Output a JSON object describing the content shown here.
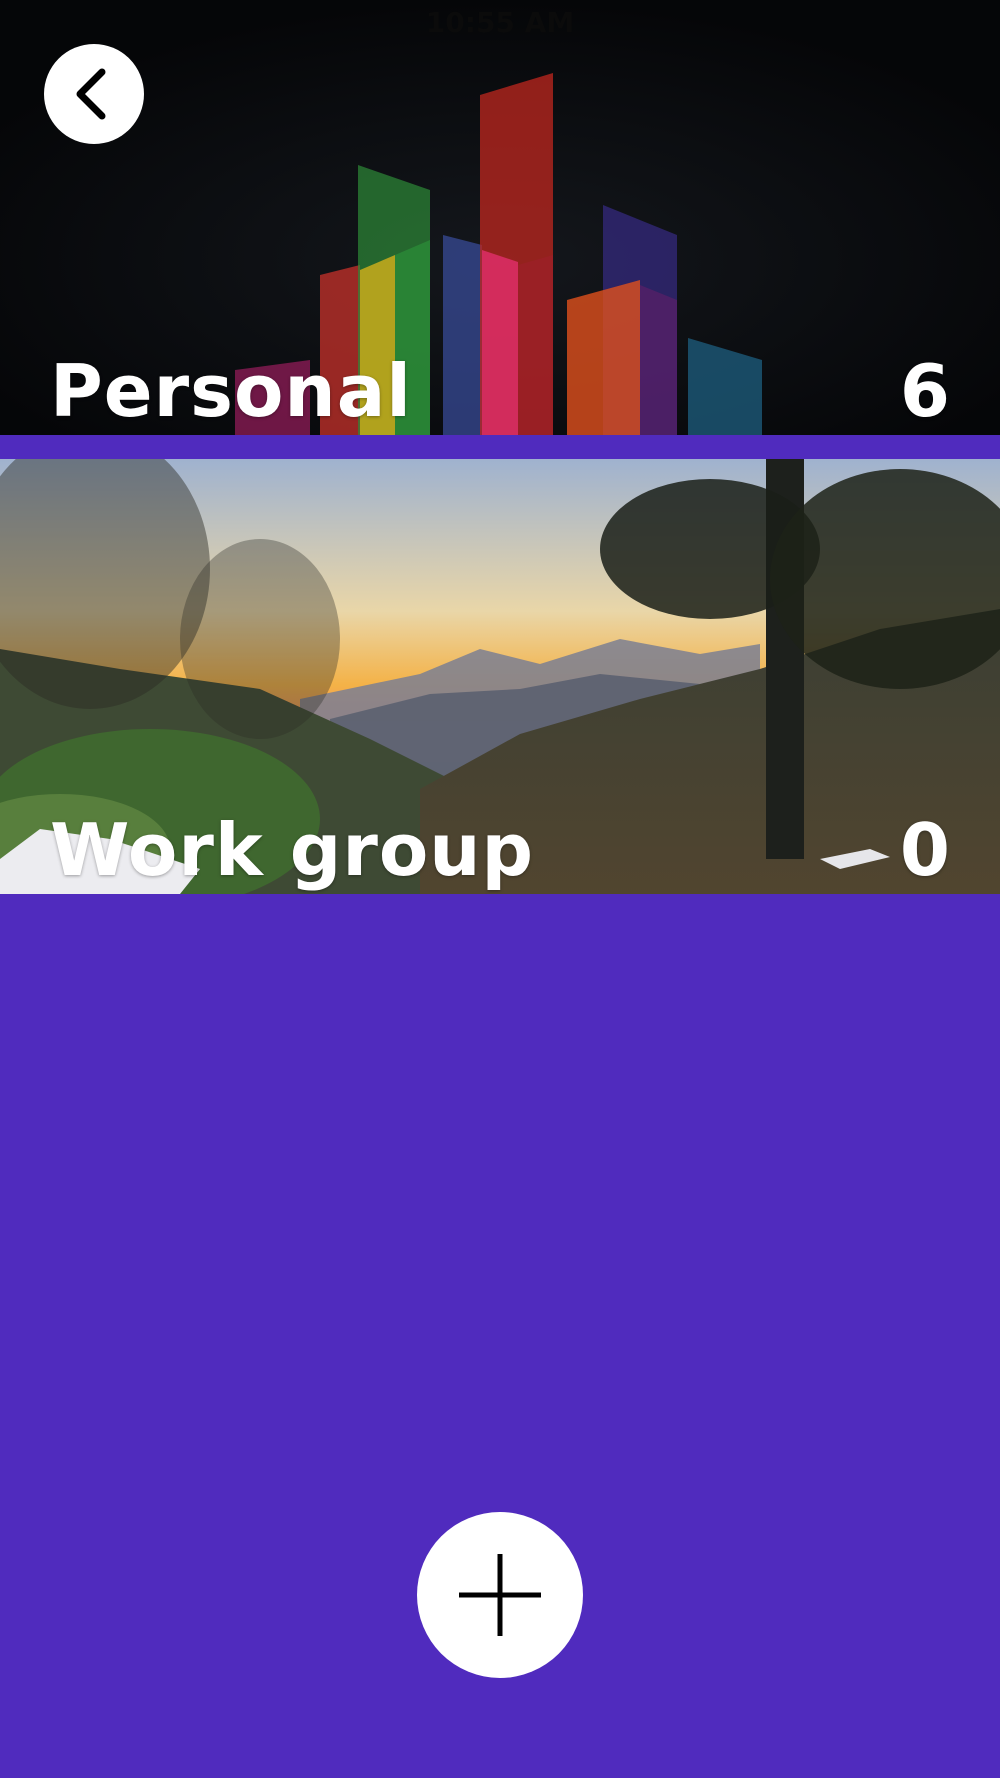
{
  "status_bar": {
    "time": "10:55 AM"
  },
  "navigation": {
    "back_icon": "chevron-left-icon"
  },
  "groups": [
    {
      "name": "Personal",
      "count": "6",
      "background": "colorful-bars-image"
    },
    {
      "name": "Work group",
      "count": "0",
      "background": "mountain-sunset-image"
    }
  ],
  "actions": {
    "add_icon": "plus-icon"
  },
  "colors": {
    "background": "#502bbe",
    "button": "#ffffff",
    "icon": "#000000",
    "text": "#ffffff"
  }
}
